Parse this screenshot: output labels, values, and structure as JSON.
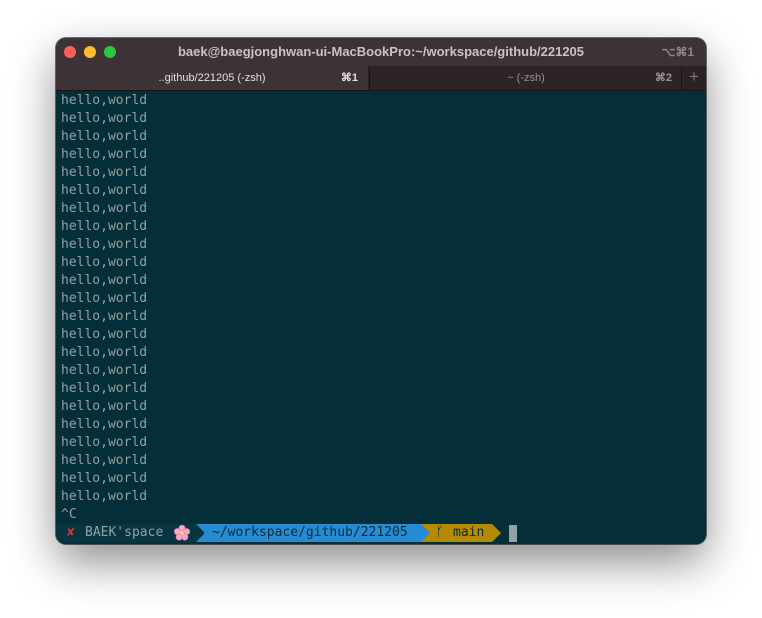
{
  "window": {
    "title": "baek@baegjonghwan-ui-MacBookPro:~/workspace/github/221205",
    "shortcut": "⌥⌘1"
  },
  "tabs": [
    {
      "label": "..github/221205 (-zsh)",
      "key": "⌘1",
      "active": true
    },
    {
      "label": "~ (-zsh)",
      "key": "⌘2",
      "active": false
    }
  ],
  "new_tab_label": "+",
  "terminal": {
    "lines": [
      "hello,world",
      "hello,world",
      "hello,world",
      "hello,world",
      "hello,world",
      "hello,world",
      "hello,world",
      "hello,world",
      "hello,world",
      "hello,world",
      "hello,world",
      "hello,world",
      "hello,world",
      "hello,world",
      "hello,world",
      "hello,world",
      "hello,world",
      "hello,world",
      "hello,world",
      "hello,world",
      "hello,world",
      "hello,world",
      "hello,world",
      "^C"
    ],
    "prompt": {
      "status_symbol": "✘",
      "context": "BAEK'space",
      "context_icon": "flower-icon",
      "directory": "~/workspace/github/221205",
      "branch_symbol": "ᚶ",
      "branch": "main"
    }
  },
  "colors": {
    "background": "#042e38",
    "foreground": "#93a1a1",
    "directory_segment": "#268bd2",
    "git_segment": "#b58900",
    "error": "#dc322f"
  }
}
